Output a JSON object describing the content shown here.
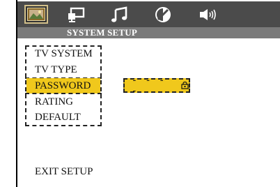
{
  "tabs": [
    {
      "icon": "general-setup-icon"
    },
    {
      "icon": "video-setup-icon"
    },
    {
      "icon": "audio-setup-icon"
    },
    {
      "icon": "preference-setup-icon"
    },
    {
      "icon": "speaker-setup-icon"
    }
  ],
  "section_title": "SYSTEM SETUP",
  "menu": {
    "items": [
      "TV SYSTEM",
      "TV TYPE",
      "PASSWORD",
      "RATING",
      "DEFAULT"
    ],
    "selected": "PASSWORD"
  },
  "password": {
    "value": "- - - -",
    "icon": "lock-icon"
  },
  "exit_label": "EXIT SETUP",
  "colors": {
    "highlight": "#f0c81c",
    "tab_bar": "#4b4b4b",
    "sub_bar": "#7a7a7a",
    "selected_tab_border": "#d2c08a"
  }
}
